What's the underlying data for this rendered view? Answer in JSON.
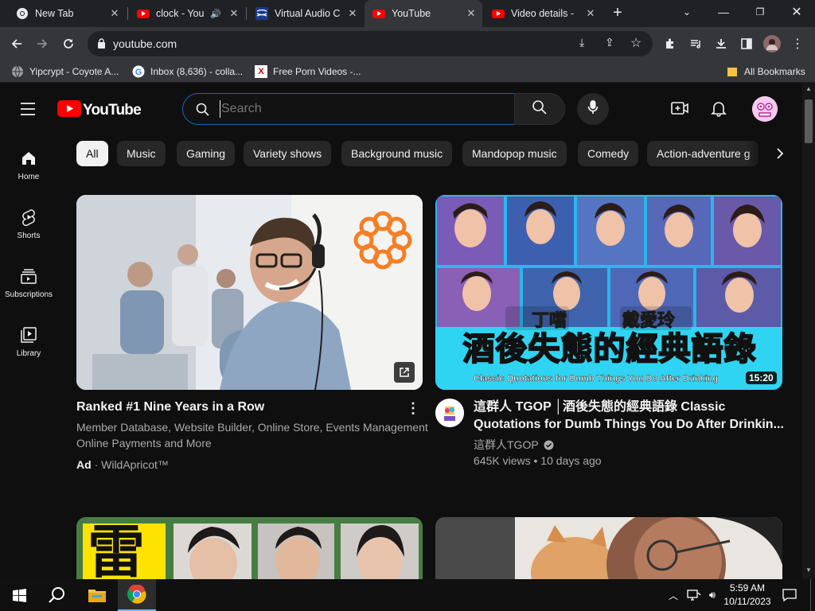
{
  "browser": {
    "tabs": [
      {
        "title": "New Tab",
        "favicon": "chrome-icon"
      },
      {
        "title": "clock - You",
        "favicon": "youtube-icon",
        "audio": true
      },
      {
        "title": "Virtual Audio C",
        "favicon": "virtual-audio-icon"
      },
      {
        "title": "YouTube",
        "favicon": "youtube-icon",
        "active": true
      },
      {
        "title": "Video details -",
        "favicon": "youtube-icon"
      }
    ],
    "url": "youtube.com",
    "bookmarks": [
      {
        "label": "Yipcrypt - Coyote A...",
        "icon": "globe-icon"
      },
      {
        "label": "Inbox (8,636) - colla...",
        "icon": "google-icon"
      },
      {
        "label": "Free Porn Videos -...",
        "icon": "x-icon"
      }
    ],
    "all_bookmarks": "All Bookmarks"
  },
  "youtube": {
    "logo_text": "YouTube",
    "search_placeholder": "Search",
    "chips": [
      "All",
      "Music",
      "Gaming",
      "Variety shows",
      "Background music",
      "Mandopop music",
      "Comedy",
      "Action-adventure g"
    ],
    "sidebar": [
      {
        "label": "Home",
        "icon": "home-icon"
      },
      {
        "label": "Shorts",
        "icon": "shorts-icon"
      },
      {
        "label": "Subscriptions",
        "icon": "subscriptions-icon"
      },
      {
        "label": "Library",
        "icon": "library-icon"
      }
    ],
    "videos": [
      {
        "title": "Ranked #1 Nine Years in a Row",
        "desc_line1": "Member Database, Website Builder, Online Store, Events Management",
        "desc_line2": "Online Payments and More",
        "ad_label": "Ad",
        "advertiser": "WildApricot™"
      },
      {
        "title_line1": "這群人 TGOP │酒後失態的經典語錄 Classic",
        "title_line2": "Quotations for Dumb Things You Do After Drinkin...",
        "channel": "這群人TGOP",
        "views": "645K views",
        "age": "10 days ago",
        "duration": "15:20",
        "thumb_big_text": "酒後失態的經典語錄",
        "thumb_sub_text": "Classic Quotations for Dumb Things You Do After Drinking",
        "thumb_name_left": "丁噹",
        "thumb_name_right": "戴愛玲"
      }
    ],
    "row2_thumb_text": "雷"
  },
  "taskbar": {
    "time": "5:59 AM",
    "date": "10/11/2023"
  }
}
